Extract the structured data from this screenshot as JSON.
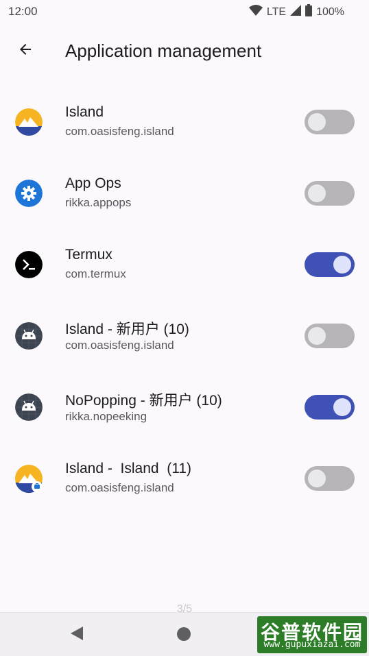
{
  "status_bar": {
    "time": "12:00",
    "network": "LTE",
    "battery": "100%",
    "icons": [
      "wifi-icon",
      "cell-signal-icon",
      "battery-icon"
    ]
  },
  "app_bar": {
    "title": "Application management",
    "back_icon": "arrow-back-icon"
  },
  "apps": [
    {
      "name": "Island",
      "package": "com.oasisfeng.island",
      "enabled": false,
      "icon": "island-icon"
    },
    {
      "name": "App Ops",
      "package": "rikka.appops",
      "enabled": false,
      "icon": "appops-gear-icon"
    },
    {
      "name": "Termux",
      "package": "com.termux",
      "enabled": true,
      "icon": "termux-icon"
    },
    {
      "name": "Island - 新用户 (10)",
      "package": "com.oasisfeng.island",
      "enabled": false,
      "icon": "android-icon"
    },
    {
      "name": "NoPopping - 新用户 (10)",
      "package": "rikka.nopeeking",
      "enabled": true,
      "icon": "android-icon"
    },
    {
      "name": "Island -  Island  (11)",
      "package": "com.oasisfeng.island",
      "enabled": false,
      "icon": "island-work-icon"
    }
  ],
  "page_indicator": "3/5",
  "nav_bar": {
    "back_icon": "nav-back-icon",
    "home_icon": "nav-home-icon"
  },
  "watermark": {
    "main": "谷普软件园",
    "url": "www.gupuxiazai.com"
  },
  "colors": {
    "accent": "#3f51b5",
    "toggle_off": "#b6b4b9",
    "background": "#fcf9fd"
  }
}
